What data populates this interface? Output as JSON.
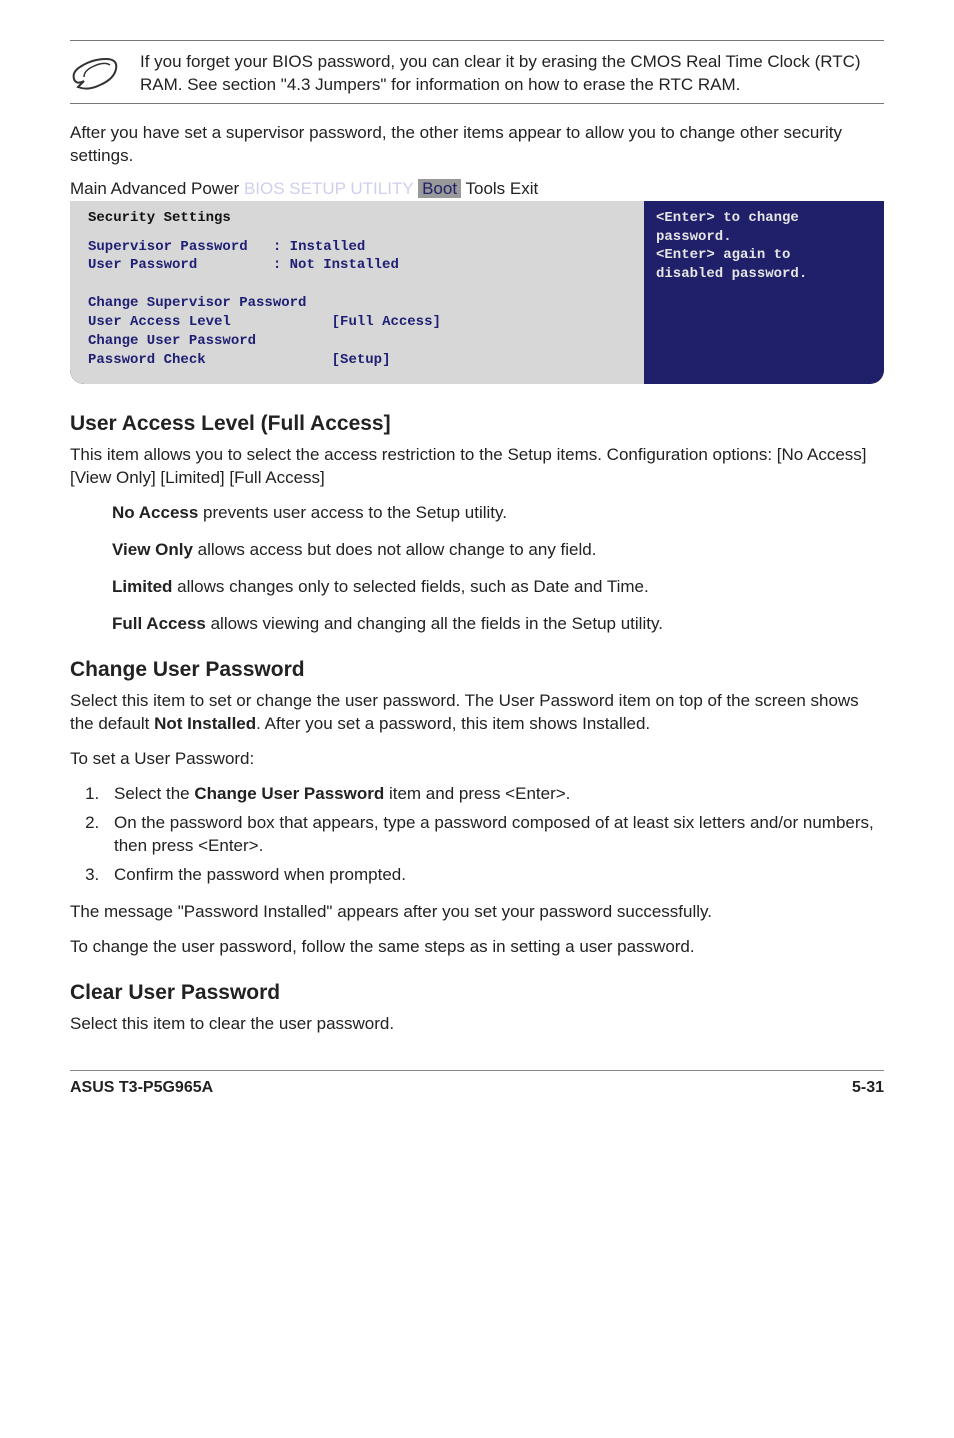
{
  "note": {
    "text": "If you forget your BIOS password, you can clear it by erasing the CMOS Real Time Clock (RTC) RAM. See section \"4.3 Jumpers\" for information on how to erase the RTC RAM."
  },
  "intro": "After you have set a supervisor password, the other items appear to allow you to change other security settings.",
  "bios": {
    "title": "BIOS SETUP UTILITY",
    "tabs": {
      "main": "Main",
      "advanced": "Advanced",
      "power": "Power",
      "boot": "Boot",
      "tools": "Tools",
      "exit": "Exit"
    },
    "left": {
      "heading": "Security Settings",
      "sup_label": "Supervisor Password",
      "sup_val": ": Installed",
      "usr_label": "User Password",
      "usr_val": ": Not Installed",
      "csp": "Change Supervisor Password",
      "ual_label": "User Access Level",
      "ual_val": "[Full Access]",
      "cup": "Change User Password",
      "pc_label": "Password Check",
      "pc_val": "[Setup]"
    },
    "right": {
      "l1": "<Enter> to change",
      "l2": "password.",
      "l3": "<Enter> again to",
      "l4": "disabled password."
    }
  },
  "sections": {
    "ual": {
      "heading": "User Access Level (Full Access]",
      "para": "This item allows you to select the access restriction to the Setup items. Configuration options: [No Access] [View Only] [Limited] [Full Access]",
      "na_b": "No Access",
      "na_t": " prevents user access to the Setup utility.",
      "vo_b": "View Only",
      "vo_t": " allows access but does not allow change to any field.",
      "li_b": "Limited",
      "li_t": " allows changes only to selected fields, such as Date and Time.",
      "fa_b": "Full Access",
      "fa_t": " allows viewing and changing all the fields in the Setup utility."
    },
    "cup": {
      "heading": "Change User Password",
      "p1a": "Select this item to set or change the user password. The User Password item on top of the screen shows the default ",
      "p1b": "Not Installed",
      "p1c": ". After you set a password, this item shows Installed.",
      "p2": "To set a User Password:",
      "step1a": "Select the ",
      "step1b": "Change User Password",
      "step1c": " item and press <Enter>.",
      "step2": "On the password box that appears, type a password composed of at least six letters and/or numbers, then press <Enter>.",
      "step3": "Confirm the password when prompted.",
      "p3": "The message \"Password Installed\" appears after you set your password successfully.",
      "p4": "To change the user password, follow the same steps as in setting a user password."
    },
    "clr": {
      "heading": "Clear User Password",
      "para": "Select this item to clear the user password."
    }
  },
  "footer": {
    "left": "ASUS T3-P5G965A",
    "right": "5-31"
  }
}
